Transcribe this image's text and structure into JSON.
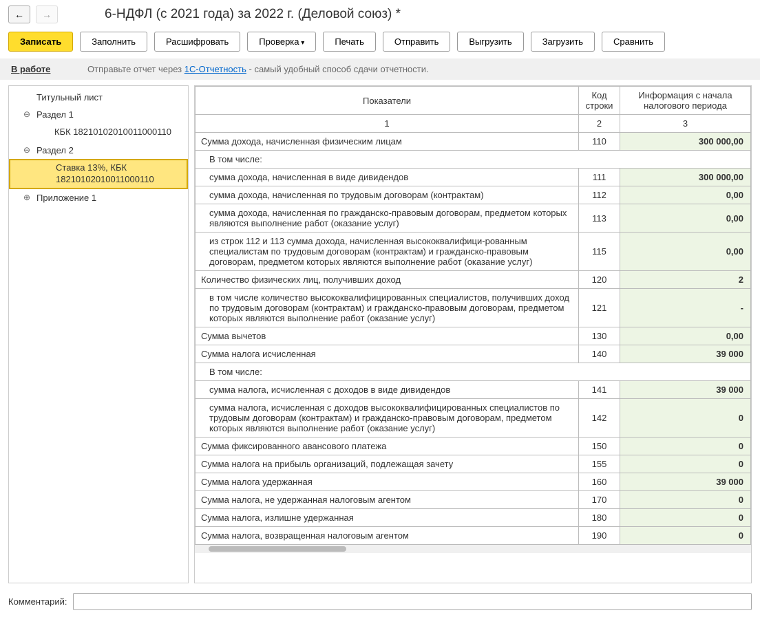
{
  "header": {
    "title": "6-НДФЛ (с 2021 года) за 2022 г. (Деловой союз) *"
  },
  "toolbar": {
    "save": "Записать",
    "fill": "Заполнить",
    "decode": "Расшифровать",
    "check": "Проверка",
    "print": "Печать",
    "send": "Отправить",
    "export": "Выгрузить",
    "import": "Загрузить",
    "compare": "Сравнить"
  },
  "status": {
    "label": "В работе",
    "text_before": "Отправьте отчет через ",
    "link": "1С-Отчетность",
    "text_after": " - самый удобный способ сдачи отчетности."
  },
  "tree": {
    "title_page": "Титульный лист",
    "section1": "Раздел 1",
    "kbk1": "КБК 18210102010011000110",
    "section2": "Раздел 2",
    "rate_kbk": "Ставка 13%, КБК 18210102010011000110",
    "appendix": "Приложение 1"
  },
  "table": {
    "headers": {
      "indicator": "Показатели",
      "code": "Код строки",
      "info": "Информация с начала налогового периода",
      "col1": "1",
      "col2": "2",
      "col3": "3"
    },
    "rows": [
      {
        "label": "Сумма дохода, начисленная физическим лицам",
        "code": "110",
        "value": "300 000,00"
      },
      {
        "label": "В том числе:",
        "code": "",
        "value": "",
        "header": true
      },
      {
        "label": "сумма дохода, начисленная в виде дивидендов",
        "code": "111",
        "value": "300 000,00",
        "sub": true
      },
      {
        "label": "сумма дохода, начисленная по трудовым договорам (контрактам)",
        "code": "112",
        "value": "0,00",
        "sub": true
      },
      {
        "label": "сумма дохода, начисленная по гражданско-правовым договорам, предметом которых являются выполнение работ (оказание услуг)",
        "code": "113",
        "value": "0,00",
        "sub": true
      },
      {
        "label": "из строк 112 и 113 сумма дохода, начисленная высококвалифици-рованным специалистам по трудовым договорам (контрактам) и гражданско-правовым договорам, предметом которых являются выполнение работ (оказание услуг)",
        "code": "115",
        "value": "0,00",
        "sub": true
      },
      {
        "label": "Количество физических лиц, получивших доход",
        "code": "120",
        "value": "2"
      },
      {
        "label": "в том числе количество высококвалифицированных специалистов, получивших доход по трудовым договорам (контрактам) и гражданско-правовым договорам, предметом которых являются выполнение работ (оказание услуг)",
        "code": "121",
        "value": "-",
        "sub": true
      },
      {
        "label": "Сумма вычетов",
        "code": "130",
        "value": "0,00"
      },
      {
        "label": "Сумма налога исчисленная",
        "code": "140",
        "value": "39 000"
      },
      {
        "label": "В том числе:",
        "code": "",
        "value": "",
        "header": true
      },
      {
        "label": "сумма налога, исчисленная с доходов в виде дивидендов",
        "code": "141",
        "value": "39 000",
        "sub": true
      },
      {
        "label": "сумма налога, исчисленная с доходов высококвалифицированных специалистов по трудовым договорам (контрактам) и гражданско-правовым договорам, предметом которых являются выполнение работ (оказание услуг)",
        "code": "142",
        "value": "0",
        "sub": true
      },
      {
        "label": "Сумма фиксированного авансового платежа",
        "code": "150",
        "value": "0"
      },
      {
        "label": "Сумма налога на прибыль организаций, подлежащая зачету",
        "code": "155",
        "value": "0"
      },
      {
        "label": "Сумма налога удержанная",
        "code": "160",
        "value": "39 000"
      },
      {
        "label": "Сумма налога, не удержанная налоговым агентом",
        "code": "170",
        "value": "0"
      },
      {
        "label": "Сумма налога, излишне удержанная",
        "code": "180",
        "value": "0"
      },
      {
        "label": "Сумма налога, возвращенная налоговым агентом",
        "code": "190",
        "value": "0"
      }
    ]
  },
  "comment": {
    "label": "Комментарий:",
    "value": ""
  }
}
